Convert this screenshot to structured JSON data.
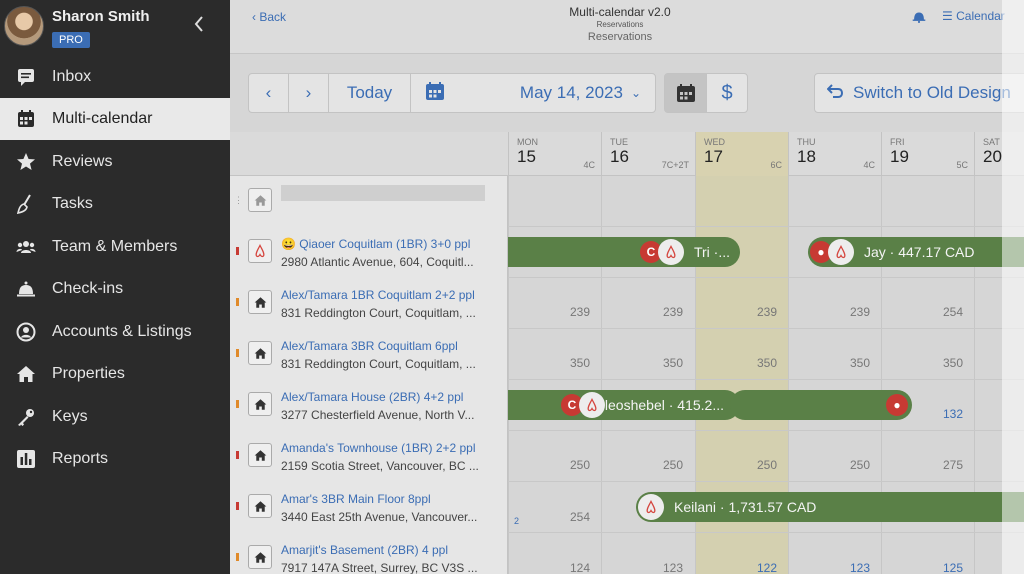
{
  "user": {
    "name": "Sharon Smith",
    "plan": "PRO"
  },
  "nav": [
    {
      "label": "Inbox",
      "icon": "inbox-icon"
    },
    {
      "label": "Multi-calendar",
      "icon": "calendar-icon",
      "active": true
    },
    {
      "label": "Reviews",
      "icon": "star-icon"
    },
    {
      "label": "Tasks",
      "icon": "broom-icon"
    },
    {
      "label": "Team & Members",
      "icon": "team-icon"
    },
    {
      "label": "Check-ins",
      "icon": "bell-icon"
    },
    {
      "label": "Accounts & Listings",
      "icon": "user-circle-icon"
    },
    {
      "label": "Properties",
      "icon": "home-icon"
    },
    {
      "label": "Keys",
      "icon": "key-icon"
    },
    {
      "label": "Reports",
      "icon": "reports-icon"
    }
  ],
  "header": {
    "back": "Back",
    "title": "Multi-calendar v2.0",
    "subtitle": "Reservations",
    "ghost_subtitle": "Reservations",
    "calendar_link": "Calendar"
  },
  "toolbar": {
    "prev": "‹",
    "next": "›",
    "today": "Today",
    "date": "May 14, 2023",
    "currency_icon": "$",
    "switch_label": "Switch to Old Design"
  },
  "days": [
    {
      "name": "MON",
      "num": "15",
      "count": "4C"
    },
    {
      "name": "TUE",
      "num": "16",
      "count": "7C+2T"
    },
    {
      "name": "WED",
      "num": "17",
      "count": "6C",
      "today": true
    },
    {
      "name": "THU",
      "num": "18",
      "count": "4C"
    },
    {
      "name": "FRI",
      "num": "19",
      "count": "5C"
    },
    {
      "name": "SAT",
      "num": "20",
      "count": ""
    }
  ],
  "listings": [
    {
      "name": "😀 Qiaoer Coquitlam (1BR) 3+0 ppl",
      "address": "2980 Atlantic Avenue, 604, Coquitl...",
      "icon": "airbnb-icon"
    },
    {
      "name": "Alex/Tamara 1BR Coquitlam 2+2 ppl",
      "address": "831 Reddington Court, Coquitlam, ...",
      "icon": "home-icon"
    },
    {
      "name": "Alex/Tamara 3BR Coquitlam 6ppl",
      "address": "831 Reddington Court, Coquitlam, ...",
      "icon": "home-icon"
    },
    {
      "name": "Alex/Tamara House (2BR) 4+2 ppl",
      "address": "3277 Chesterfield Avenue, North V...",
      "icon": "home-icon"
    },
    {
      "name": "Amanda's Townhouse (1BR) 2+2 ppl",
      "address": "2159 Scotia Street, Vancouver, BC ...",
      "icon": "home-icon"
    },
    {
      "name": "Amar's 3BR Main Floor 8ppl",
      "address": "3440 East 25th Avenue, Vancouver...",
      "icon": "home-icon"
    },
    {
      "name": "Amarjit's Basement (2BR) 4 ppl",
      "address": "7917 147A Street, Surrey, BC V3S ...",
      "icon": "home-icon"
    }
  ],
  "prices": {
    "row2": [
      "239",
      "239",
      "239",
      "239",
      "254"
    ],
    "row3": [
      "350",
      "350",
      "350",
      "350",
      "350"
    ],
    "row4_fri": "132",
    "row5": [
      "250",
      "250",
      "250",
      "250",
      "275"
    ],
    "row6_mon": "254",
    "row6_small": "2",
    "row7": [
      "124",
      "123",
      "122",
      "123",
      "125"
    ]
  },
  "bookings": {
    "b1": "Tri ·...",
    "b2": "Jay · 447.17 CAD",
    "b3": "leoshebel · 415.2...",
    "b4": "Keilani · 1,731.57 CAD"
  },
  "colors": {
    "accent": "#3b6db4",
    "booking": "#5a8047",
    "badge": "#c73a33",
    "sidebar": "#2b2b2b"
  }
}
